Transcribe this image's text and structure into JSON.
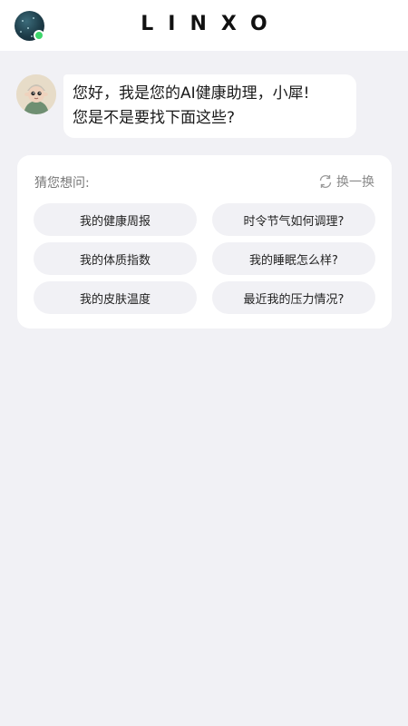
{
  "header": {
    "brand": "LINXO",
    "avatar_icon": "user-avatar-icon",
    "status_color": "#3dd66b"
  },
  "chat": {
    "assistant_avatar_icon": "assistant-avatar-icon",
    "message_lines": [
      "您好，我是您的AI健康助理，小犀!",
      "您是不是要找下面这些?"
    ]
  },
  "suggestions": {
    "title": "猜您想问:",
    "refresh_label": "换一换",
    "refresh_icon": "refresh-icon",
    "items": [
      "我的健康周报",
      "时令节气如何调理?",
      "我的体质指数",
      "我的睡眠怎么样?",
      "我的皮肤温度",
      "最近我的压力情况?"
    ]
  },
  "colors": {
    "background": "#f1f1f5",
    "card": "#ffffff",
    "chip": "#f1f1f5"
  }
}
